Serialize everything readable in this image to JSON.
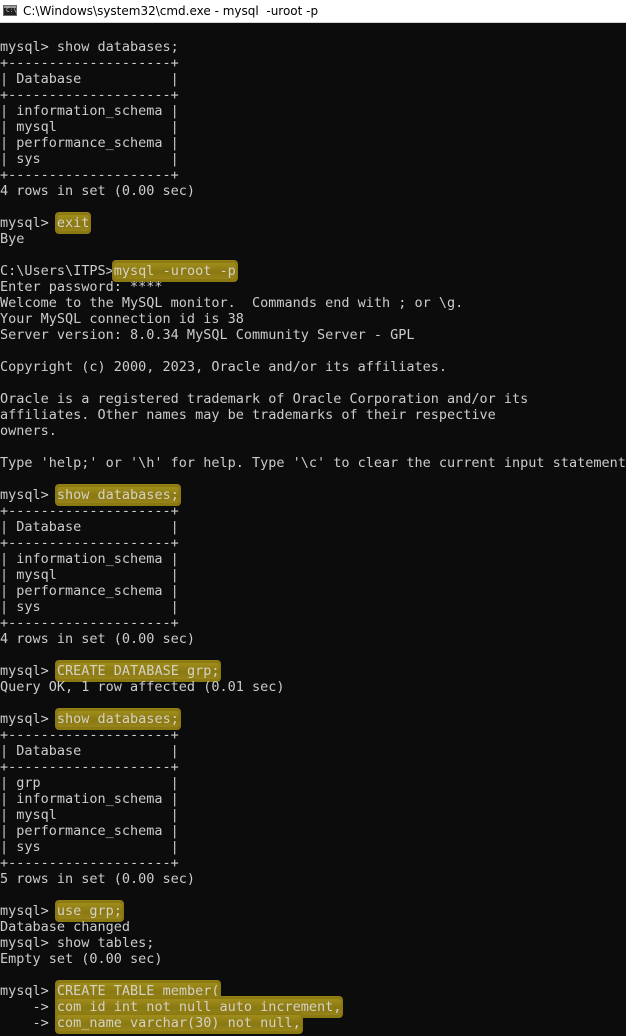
{
  "window": {
    "title": "C:\\Windows\\system32\\cmd.exe - mysql  -uroot -p",
    "icon": "cmd-icon",
    "icon_text": "C:\\"
  },
  "colors": {
    "console_background": "#0c0c0c",
    "console_text": "#cccccc",
    "highlight": "#8f7d14",
    "titlebar": "#ffffff"
  },
  "lines": [
    {
      "text": ""
    },
    {
      "text": "mysql> show databases;"
    },
    {
      "text": "+--------------------+"
    },
    {
      "text": "| Database           |"
    },
    {
      "text": "+--------------------+"
    },
    {
      "text": "| information_schema |"
    },
    {
      "text": "| mysql              |"
    },
    {
      "text": "| performance_schema |"
    },
    {
      "text": "| sys                |"
    },
    {
      "text": "+--------------------+"
    },
    {
      "text": "4 rows in set (0.00 sec)"
    },
    {
      "text": ""
    },
    {
      "text": "mysql> ",
      "hl": "exit"
    },
    {
      "text": "Bye"
    },
    {
      "text": ""
    },
    {
      "text": "C:\\Users\\ITPS>",
      "hl": "mysql -uroot -p"
    },
    {
      "text": "Enter password: ****"
    },
    {
      "text": "Welcome to the MySQL monitor.  Commands end with ; or \\g."
    },
    {
      "text": "Your MySQL connection id is 38"
    },
    {
      "text": "Server version: 8.0.34 MySQL Community Server - GPL"
    },
    {
      "text": ""
    },
    {
      "text": "Copyright (c) 2000, 2023, Oracle and/or its affiliates."
    },
    {
      "text": ""
    },
    {
      "text": "Oracle is a registered trademark of Oracle Corporation and/or its"
    },
    {
      "text": "affiliates. Other names may be trademarks of their respective"
    },
    {
      "text": "owners."
    },
    {
      "text": ""
    },
    {
      "text": "Type 'help;' or '\\h' for help. Type '\\c' to clear the current input statement."
    },
    {
      "text": ""
    },
    {
      "text": "mysql> ",
      "hl": "show databases;"
    },
    {
      "text": "+--------------------+"
    },
    {
      "text": "| Database           |"
    },
    {
      "text": "+--------------------+"
    },
    {
      "text": "| information_schema |"
    },
    {
      "text": "| mysql              |"
    },
    {
      "text": "| performance_schema |"
    },
    {
      "text": "| sys                |"
    },
    {
      "text": "+--------------------+"
    },
    {
      "text": "4 rows in set (0.00 sec)"
    },
    {
      "text": ""
    },
    {
      "text": "mysql> ",
      "hl": "CREATE DATABASE grp;"
    },
    {
      "text": "Query OK, 1 row affected (0.01 sec)"
    },
    {
      "text": ""
    },
    {
      "text": "mysql> ",
      "hl": "show databases;"
    },
    {
      "text": "+--------------------+"
    },
    {
      "text": "| Database           |"
    },
    {
      "text": "+--------------------+"
    },
    {
      "text": "| grp                |"
    },
    {
      "text": "| information_schema |"
    },
    {
      "text": "| mysql              |"
    },
    {
      "text": "| performance_schema |"
    },
    {
      "text": "| sys                |"
    },
    {
      "text": "+--------------------+"
    },
    {
      "text": "5 rows in set (0.00 sec)"
    },
    {
      "text": ""
    },
    {
      "text": "mysql> ",
      "hl": "use grp;"
    },
    {
      "text": "Database changed"
    },
    {
      "text": "mysql> show tables;"
    },
    {
      "text": "Empty set (0.00 sec)"
    },
    {
      "text": ""
    },
    {
      "text": "mysql> ",
      "hl": "CREATE TABLE member("
    },
    {
      "text": "    -> ",
      "hl": "com_id int not null auto_increment,"
    },
    {
      "text": "    -> ",
      "hl": "com_name varchar(30) not null,"
    }
  ]
}
